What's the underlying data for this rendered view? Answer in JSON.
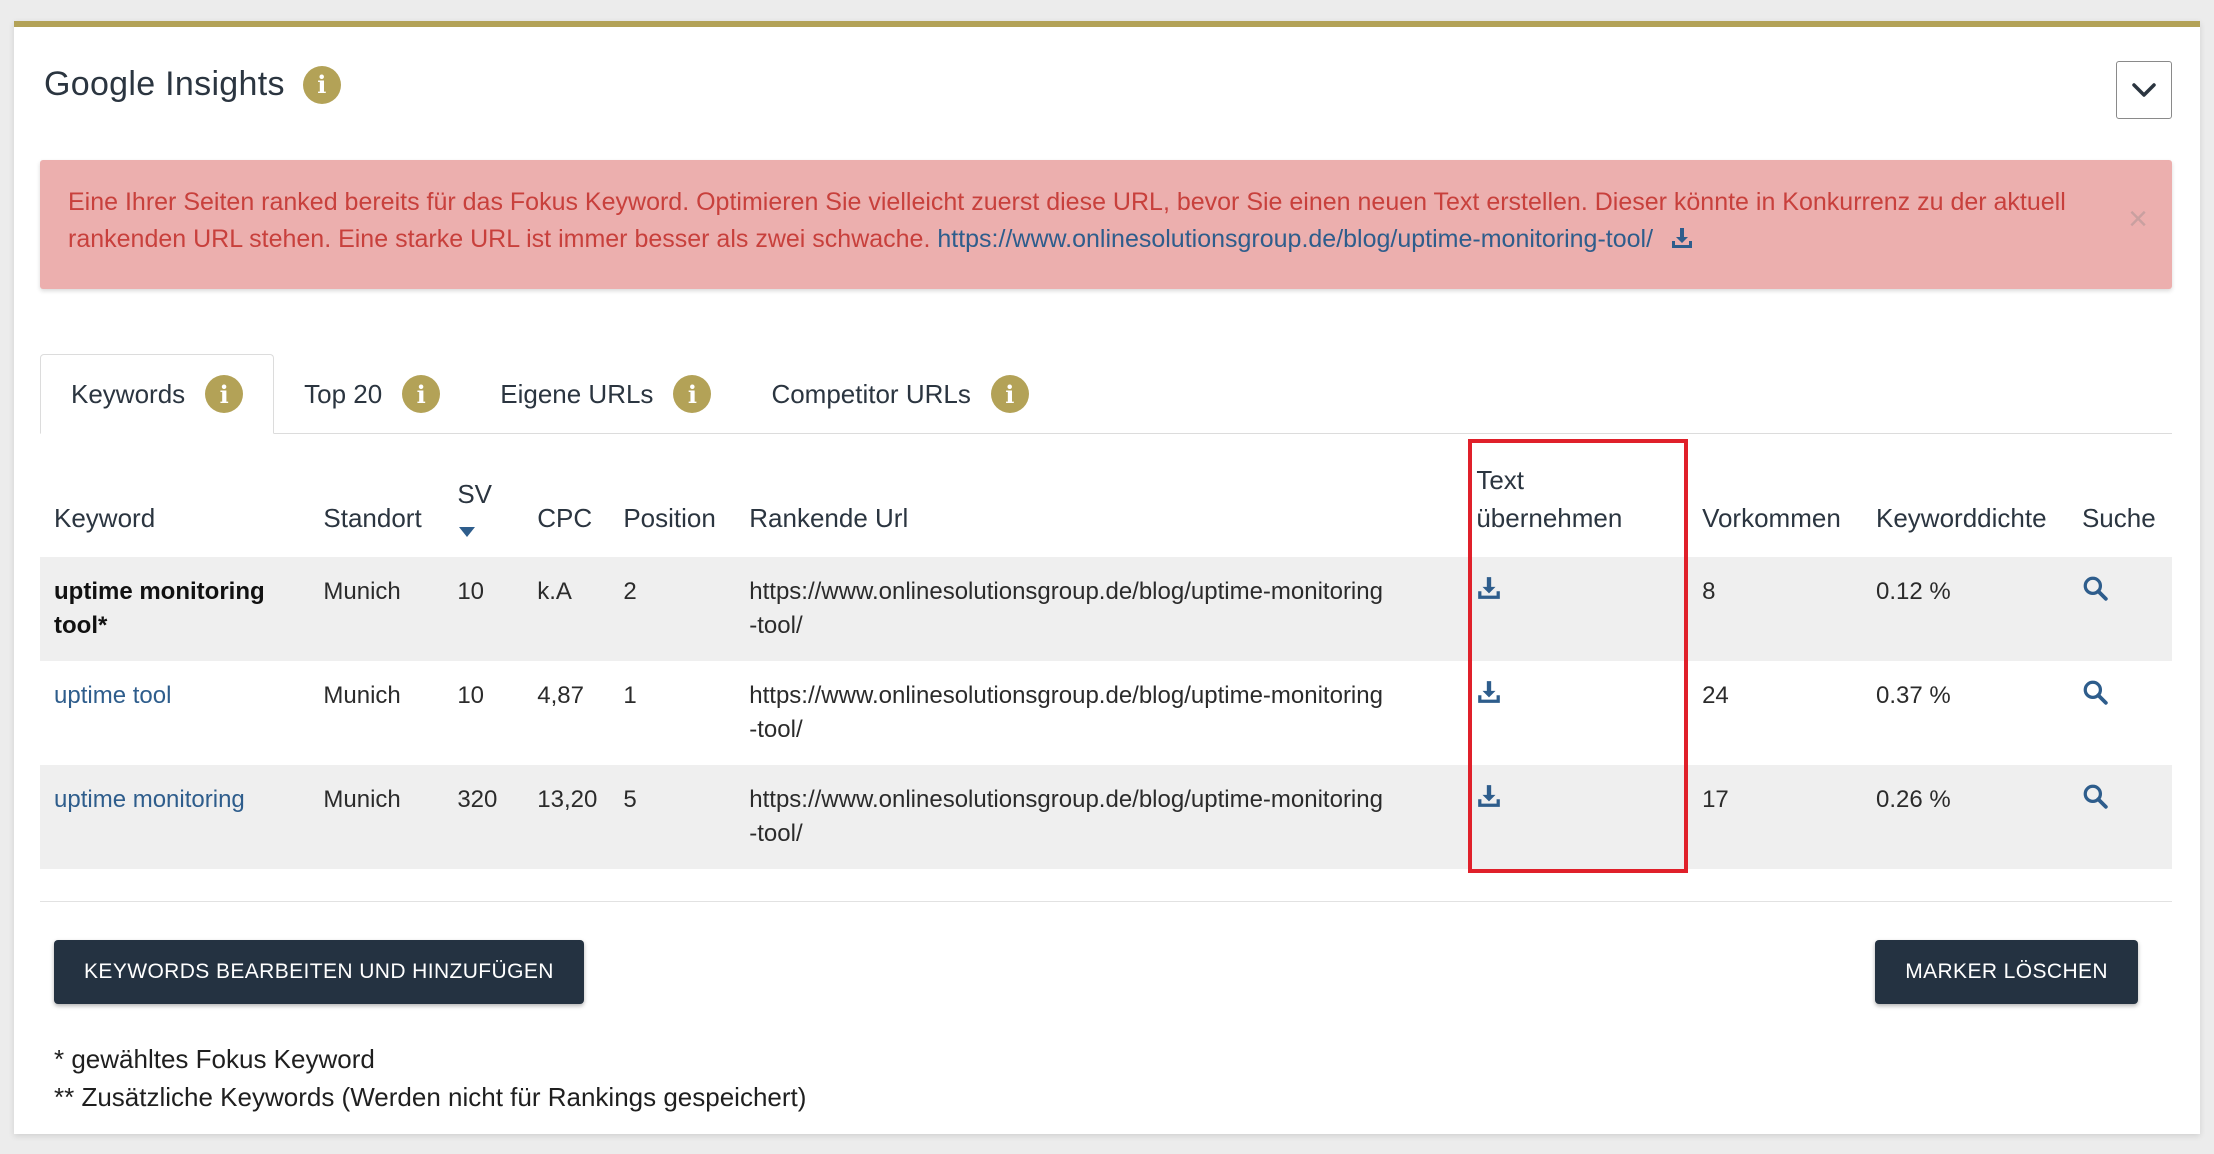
{
  "panel": {
    "title": "Google Insights",
    "info_glyph": "i",
    "collapse_icon": "chevron-down-icon"
  },
  "alert": {
    "message": "Eine Ihrer Seiten ranked bereits für das Fokus Keyword. Optimieren Sie vielleicht zuerst diese URL, bevor Sie einen neuen Text erstellen. Dieser könnte in Konkurrenz zu der aktuell rankenden URL stehen. Eine starke URL ist immer besser als zwei schwache.",
    "url": "https://www.onlinesolutionsgroup.de/blog/uptime-monitoring-tool/",
    "close": "×"
  },
  "tabs": [
    {
      "label": "Keywords",
      "active": true
    },
    {
      "label": "Top 20",
      "active": false
    },
    {
      "label": "Eigene URLs",
      "active": false
    },
    {
      "label": "Competitor URLs",
      "active": false
    }
  ],
  "table": {
    "headers": {
      "keyword": "Keyword",
      "standort": "Standort",
      "sv": "SV",
      "cpc": "CPC",
      "position": "Position",
      "rankende_url": "Rankende Url",
      "text_1": "Text",
      "text_2": "übernehmen",
      "vorkommen": "Vorkommen",
      "keyworddichte": "Keyworddichte",
      "suche": "Suche"
    },
    "rows": [
      {
        "keyword_1": "uptime monitoring",
        "keyword_2": "tool*",
        "standort": "Munich",
        "sv": "10",
        "cpc": "k.A",
        "position": "2",
        "url_1": "https://www.onlinesolutionsgroup.de/blog/uptime-monitoring",
        "url_2": "-tool/",
        "vorkommen": "8",
        "dichte": "0.12 %"
      },
      {
        "keyword": "uptime tool",
        "standort": "Munich",
        "sv": "10",
        "cpc": "4,87",
        "position": "1",
        "url_1": "https://www.onlinesolutionsgroup.de/blog/uptime-monitoring",
        "url_2": "-tool/",
        "vorkommen": "24",
        "dichte": "0.37 %"
      },
      {
        "keyword": "uptime monitoring",
        "standort": "Munich",
        "sv": "320",
        "cpc": "13,20",
        "position": "5",
        "url_1": "https://www.onlinesolutionsgroup.de/blog/uptime-monitoring",
        "url_2": "-tool/",
        "vorkommen": "17",
        "dichte": "0.26 %"
      }
    ]
  },
  "buttons": {
    "edit": "KEYWORDS BEARBEITEN UND HINZUFÜGEN",
    "clear": "MARKER LÖSCHEN"
  },
  "footnotes": {
    "line1": "* gewähltes Fokus Keyword",
    "line2": "** Zusätzliche Keywords (Werden nicht für Rankings gespeichert)"
  },
  "colors": {
    "accent": "#b3a257",
    "link": "#2e5d8c",
    "alert_bg": "#ecafae",
    "alert_text": "#c8403c",
    "button_bg": "#243241",
    "highlight": "#e0202a"
  }
}
